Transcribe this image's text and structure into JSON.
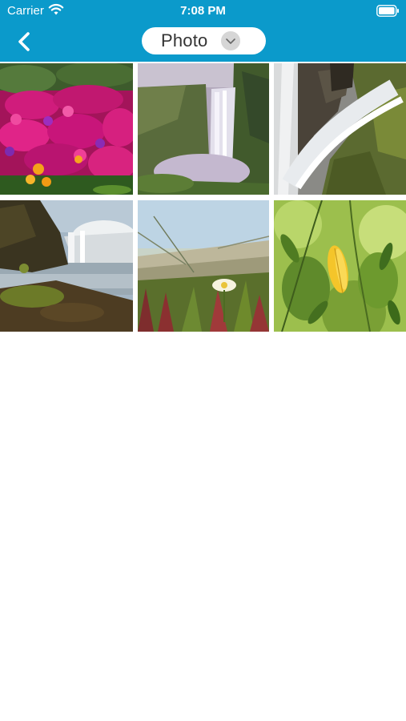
{
  "status_bar": {
    "carrier": "Carrier",
    "time": "7:08 PM",
    "wifi_icon": "wifi-icon",
    "battery_icon": "battery-icon"
  },
  "nav": {
    "back_icon": "chevron-left-icon",
    "selector_label": "Photo",
    "selector_icon": "chevron-down-icon"
  },
  "colors": {
    "accent": "#0b9acb",
    "background": "#ffffff"
  },
  "photos": [
    {
      "subject": "pink-flowers"
    },
    {
      "subject": "waterfall-cliff"
    },
    {
      "subject": "waterfall-closeup"
    },
    {
      "subject": "waterfall-coast"
    },
    {
      "subject": "beach-flower"
    },
    {
      "subject": "yellow-leaf"
    }
  ]
}
